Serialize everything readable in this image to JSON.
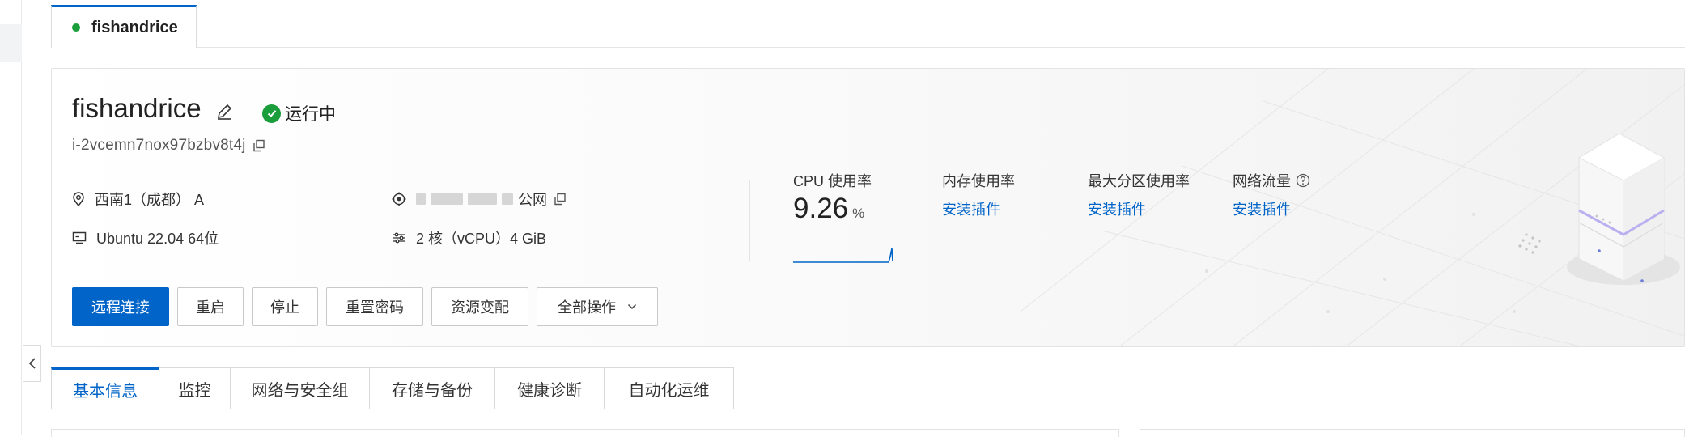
{
  "instance_tab": {
    "name": "fishandrice",
    "status_color": "#1a9e3c"
  },
  "overview": {
    "title": "fishandrice",
    "status": "运行中",
    "instance_id": "i-2vcemn7nox97bzbv8t4j",
    "region": "西南1（成都） A",
    "public_ip_suffix": "公网",
    "os": "Ubuntu 22.04 64位",
    "spec": "2 核（vCPU）4 GiB"
  },
  "metrics": {
    "cpu_label": "CPU 使用率",
    "cpu_value": "9.26",
    "cpu_unit": "%",
    "mem_label": "内存使用率",
    "mem_link": "安装插件",
    "disk_label": "最大分区使用率",
    "disk_link": "安装插件",
    "net_label": "网络流量",
    "net_link": "安装插件"
  },
  "actions": {
    "remote_connect": "远程连接",
    "restart": "重启",
    "stop": "停止",
    "reset_password": "重置密码",
    "resize": "资源变配",
    "all_actions": "全部操作"
  },
  "detail_tabs": [
    "基本信息",
    "监控",
    "网络与安全组",
    "存储与备份",
    "健康诊断",
    "自动化运维"
  ],
  "colors": {
    "accent": "#0064c8",
    "running": "#1a9e3c"
  },
  "icons": [
    "edit-icon",
    "check-circle-icon",
    "copy-icon",
    "location-icon",
    "ip-target-icon",
    "os-monitor-icon",
    "spec-sliders-icon",
    "help-circle-icon",
    "chevron-down-icon",
    "chevron-left-icon"
  ]
}
